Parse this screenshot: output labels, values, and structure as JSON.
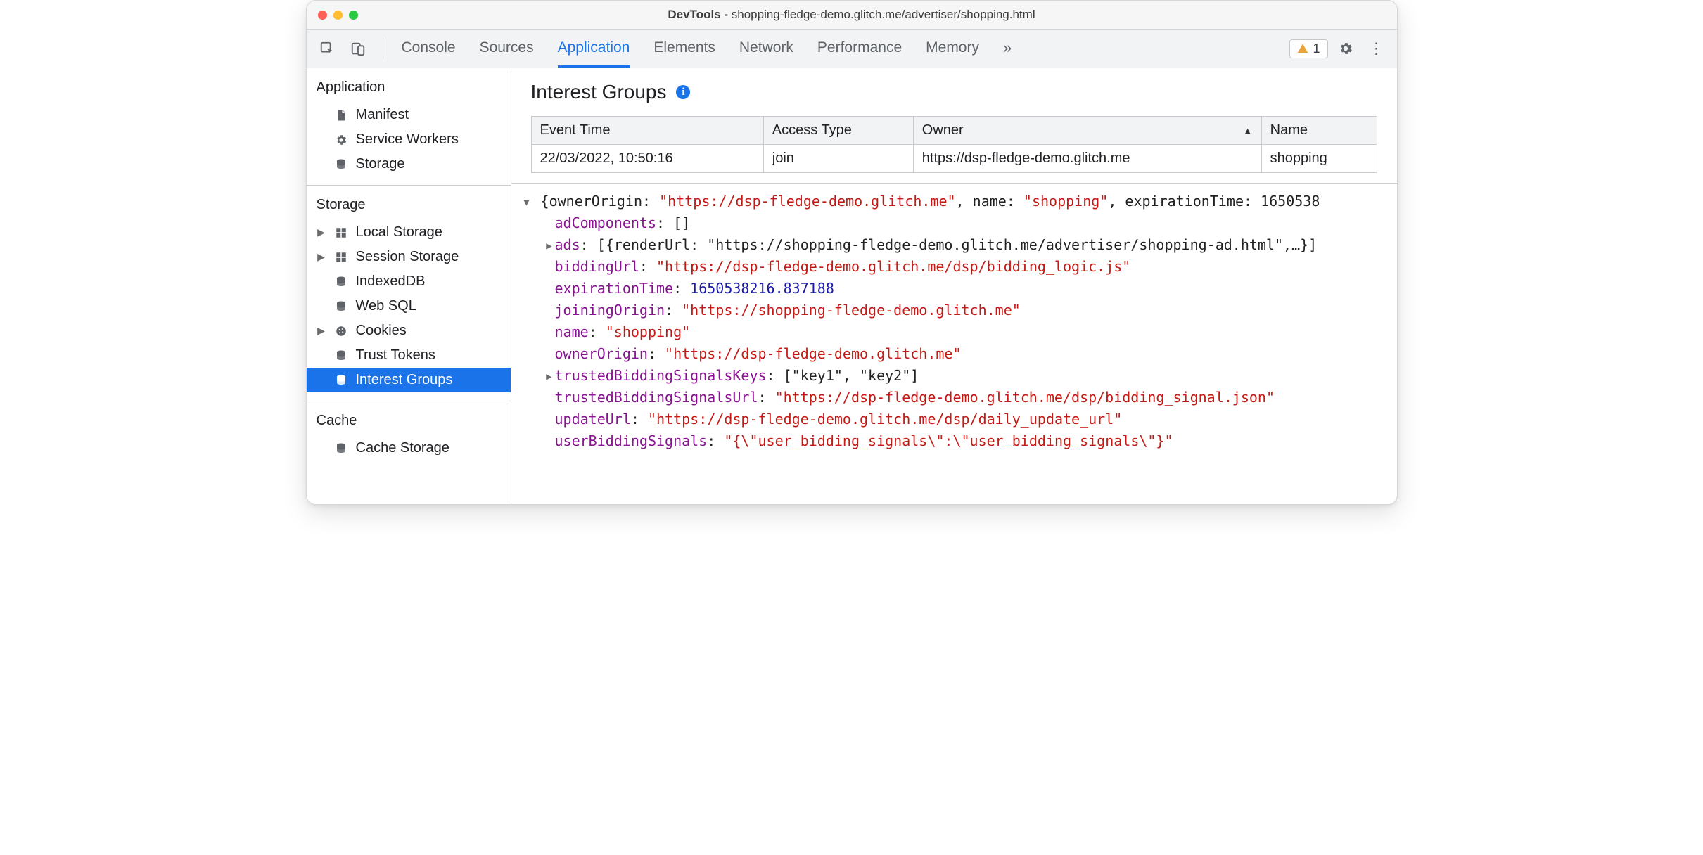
{
  "window": {
    "title_prefix": "DevTools - ",
    "title_url": "shopping-fledge-demo.glitch.me/advertiser/shopping.html"
  },
  "toolbar": {
    "tabs": [
      "Console",
      "Sources",
      "Application",
      "Elements",
      "Network",
      "Performance",
      "Memory"
    ],
    "active_tab": "Application",
    "warning_count": "1"
  },
  "sidebar": {
    "sections": [
      {
        "title": "Application",
        "items": [
          {
            "label": "Manifest",
            "icon": "file",
            "expandable": false
          },
          {
            "label": "Service Workers",
            "icon": "gear",
            "expandable": false
          },
          {
            "label": "Storage",
            "icon": "db",
            "expandable": false
          }
        ]
      },
      {
        "title": "Storage",
        "items": [
          {
            "label": "Local Storage",
            "icon": "grid",
            "expandable": true
          },
          {
            "label": "Session Storage",
            "icon": "grid",
            "expandable": true
          },
          {
            "label": "IndexedDB",
            "icon": "db",
            "expandable": false
          },
          {
            "label": "Web SQL",
            "icon": "db",
            "expandable": false
          },
          {
            "label": "Cookies",
            "icon": "cookie",
            "expandable": true
          },
          {
            "label": "Trust Tokens",
            "icon": "db",
            "expandable": false
          },
          {
            "label": "Interest Groups",
            "icon": "db",
            "expandable": false,
            "selected": true
          }
        ]
      },
      {
        "title": "Cache",
        "items": [
          {
            "label": "Cache Storage",
            "icon": "db",
            "expandable": false
          }
        ]
      }
    ]
  },
  "panel": {
    "heading": "Interest Groups",
    "table": {
      "columns": [
        "Event Time",
        "Access Type",
        "Owner",
        "Name"
      ],
      "sort_column": "Owner",
      "rows": [
        {
          "event_time": "22/03/2022, 10:50:16",
          "access_type": "join",
          "owner": "https://dsp-fledge-demo.glitch.me",
          "name": "shopping"
        }
      ]
    },
    "object": {
      "summary_ownerOrigin": "\"https://dsp-fledge-demo.glitch.me\"",
      "summary_name": "\"shopping\"",
      "summary_expirationKey": "expirationTime",
      "summary_expirationTrunc": "1650538",
      "adComponents_key": "adComponents",
      "adComponents_val": "[]",
      "ads_key": "ads",
      "ads_val": "[{renderUrl: \"https://shopping-fledge-demo.glitch.me/advertiser/shopping-ad.html\",…}]",
      "biddingUrl_key": "biddingUrl",
      "biddingUrl_val": "\"https://dsp-fledge-demo.glitch.me/dsp/bidding_logic.js\"",
      "expirationTime_key": "expirationTime",
      "expirationTime_val": "1650538216.837188",
      "joiningOrigin_key": "joiningOrigin",
      "joiningOrigin_val": "\"https://shopping-fledge-demo.glitch.me\"",
      "name_key": "name",
      "name_val": "\"shopping\"",
      "ownerOrigin_key": "ownerOrigin",
      "ownerOrigin_val": "\"https://dsp-fledge-demo.glitch.me\"",
      "tbsKeys_key": "trustedBiddingSignalsKeys",
      "tbsKeys_val": "[\"key1\", \"key2\"]",
      "tbsUrl_key": "trustedBiddingSignalsUrl",
      "tbsUrl_val": "\"https://dsp-fledge-demo.glitch.me/dsp/bidding_signal.json\"",
      "updateUrl_key": "updateUrl",
      "updateUrl_val": "\"https://dsp-fledge-demo.glitch.me/dsp/daily_update_url\"",
      "userBiddingSignals_key": "userBiddingSignals",
      "userBiddingSignals_val": "\"{\\\"user_bidding_signals\\\":\\\"user_bidding_signals\\\"}\""
    }
  }
}
